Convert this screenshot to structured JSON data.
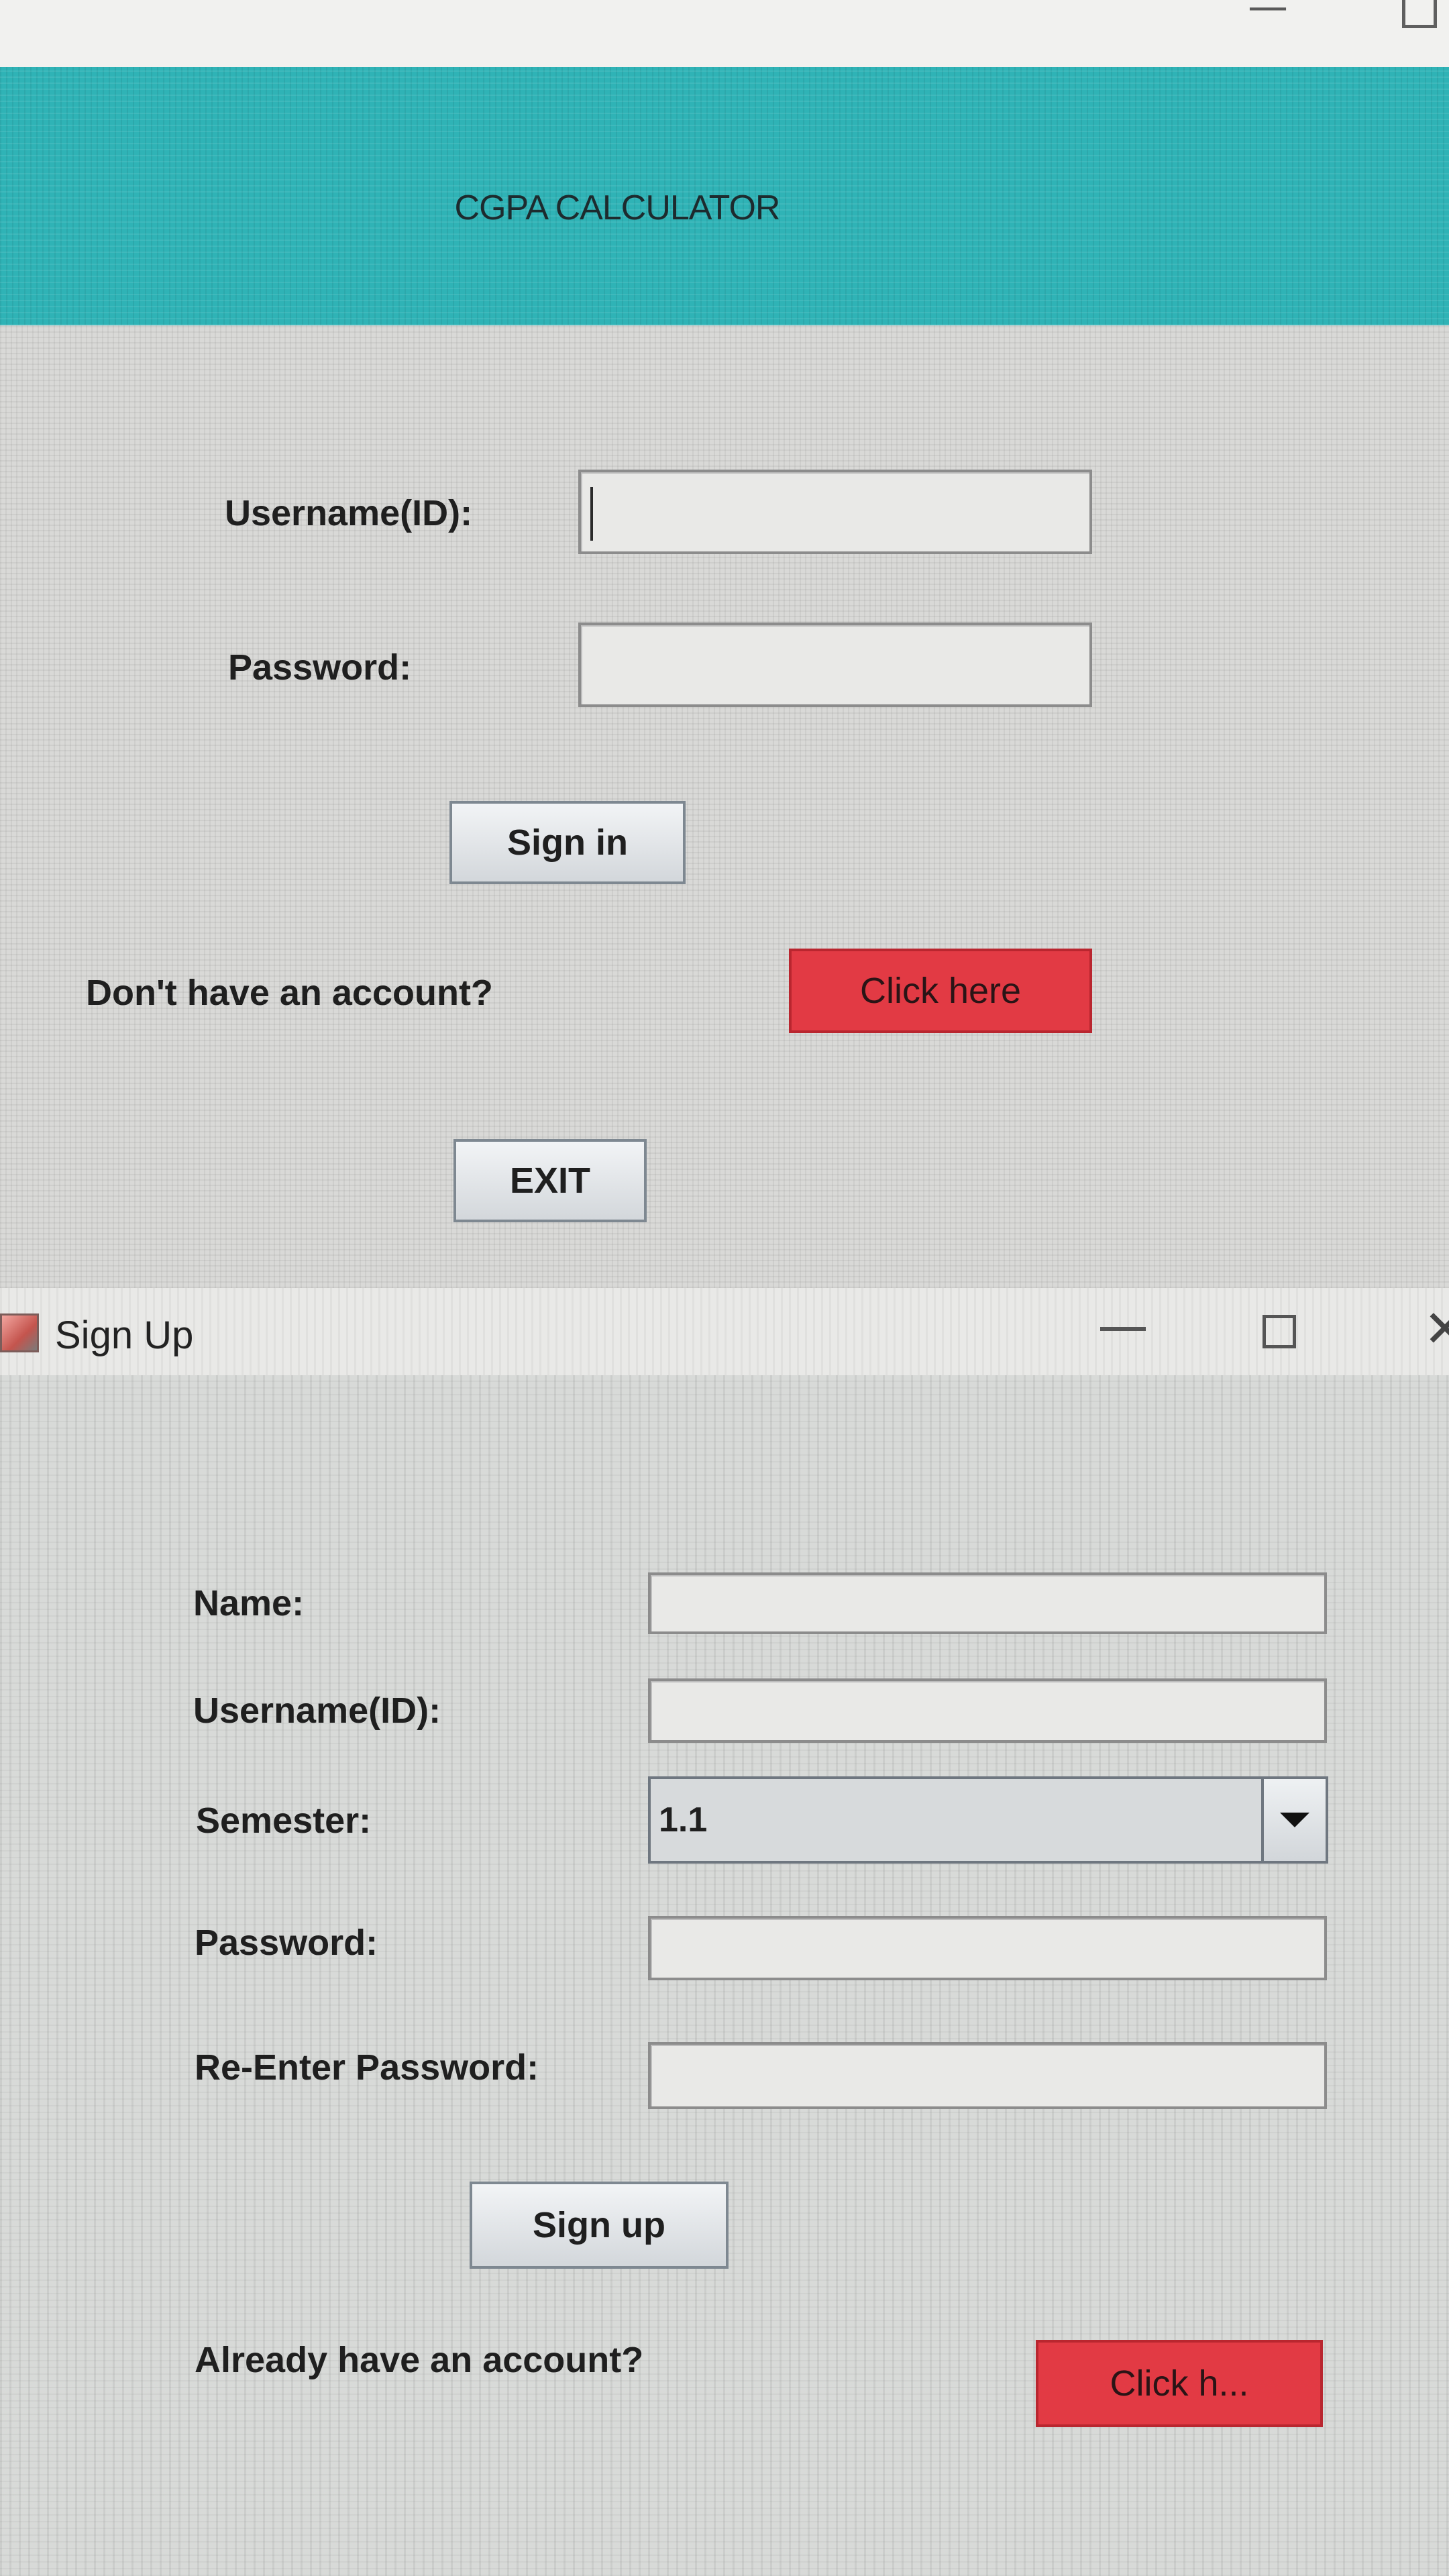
{
  "login": {
    "window_controls": {
      "minimize": "—",
      "maximize": ""
    },
    "title": "CGPA CALCULATOR",
    "username_label": "Username(ID):",
    "password_label": "Password:",
    "username_value": "",
    "password_value": "",
    "sign_in_button": "Sign in",
    "no_account_text": "Don't have an account?",
    "click_here_button": "Click here",
    "exit_button": "EXIT"
  },
  "signup": {
    "window_title": "Sign Up",
    "window_controls": {
      "close": "✕"
    },
    "name_label": "Name:",
    "username_label": "Username(ID):",
    "semester_label": "Semester:",
    "semester_selected": "1.1",
    "password_label": "Password:",
    "reenter_label": "Re-Enter Password:",
    "sign_up_button": "Sign up",
    "have_account_text": "Already have an account?",
    "click_here_button": "Click h..."
  },
  "colors": {
    "header_teal": "#2fb3b6",
    "button_red": "#e23a44",
    "window_bg": "#d9d9d7"
  }
}
